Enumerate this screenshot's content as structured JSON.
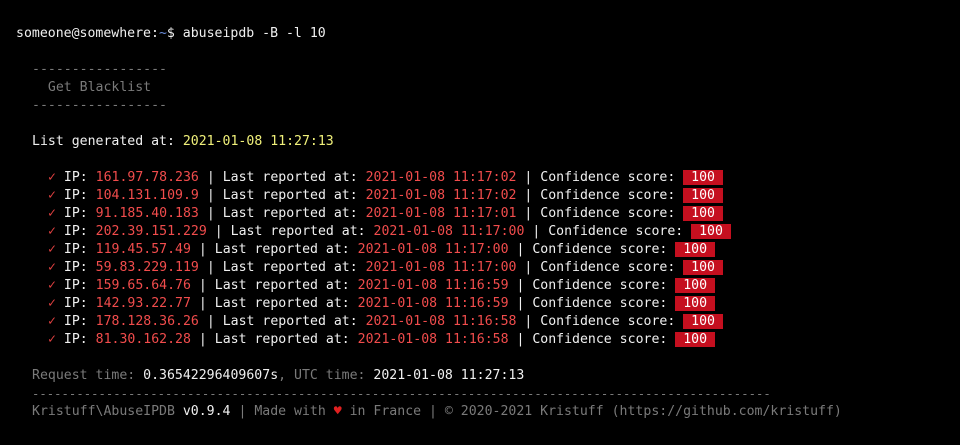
{
  "prompt": {
    "user_host": "someone@somewhere",
    "colon": ":",
    "path": "~",
    "dollar": "$ ",
    "command": "abuseipdb -B -l 10"
  },
  "header": {
    "rule_top": "-----------------",
    "title": "  Get Blacklist",
    "rule_bottom": "-----------------"
  },
  "generated": {
    "label": "List generated at: ",
    "value": "2021-01-08 11:27:13"
  },
  "rows": [
    {
      "check": "✓",
      "ip_label": " IP: ",
      "ip": "161.97.78.236",
      "sep1": " | Last reported at: ",
      "date": "2021-01-08 11:17:02",
      "sep2": " | Confidence score: ",
      "score": " 100 "
    },
    {
      "check": "✓",
      "ip_label": " IP: ",
      "ip": "104.131.109.9",
      "sep1": " | Last reported at: ",
      "date": "2021-01-08 11:17:02",
      "sep2": " | Confidence score: ",
      "score": " 100 "
    },
    {
      "check": "✓",
      "ip_label": " IP: ",
      "ip": "91.185.40.183",
      "sep1": " | Last reported at: ",
      "date": "2021-01-08 11:17:01",
      "sep2": " | Confidence score: ",
      "score": " 100 "
    },
    {
      "check": "✓",
      "ip_label": " IP: ",
      "ip": "202.39.151.229",
      "sep1": " | Last reported at: ",
      "date": "2021-01-08 11:17:00",
      "sep2": " | Confidence score: ",
      "score": " 100 "
    },
    {
      "check": "✓",
      "ip_label": " IP: ",
      "ip": "119.45.57.49",
      "sep1": " | Last reported at: ",
      "date": "2021-01-08 11:17:00",
      "sep2": " | Confidence score: ",
      "score": " 100 "
    },
    {
      "check": "✓",
      "ip_label": " IP: ",
      "ip": "59.83.229.119",
      "sep1": " | Last reported at: ",
      "date": "2021-01-08 11:17:00",
      "sep2": " | Confidence score: ",
      "score": " 100 "
    },
    {
      "check": "✓",
      "ip_label": " IP: ",
      "ip": "159.65.64.76",
      "sep1": " | Last reported at: ",
      "date": "2021-01-08 11:16:59",
      "sep2": " | Confidence score: ",
      "score": " 100 "
    },
    {
      "check": "✓",
      "ip_label": " IP: ",
      "ip": "142.93.22.77",
      "sep1": " | Last reported at: ",
      "date": "2021-01-08 11:16:59",
      "sep2": " | Confidence score: ",
      "score": " 100 "
    },
    {
      "check": "✓",
      "ip_label": " IP: ",
      "ip": "178.128.36.26",
      "sep1": " | Last reported at: ",
      "date": "2021-01-08 11:16:58",
      "sep2": " | Confidence score: ",
      "score": " 100 "
    },
    {
      "check": "✓",
      "ip_label": " IP: ",
      "ip": "81.30.162.28",
      "sep1": " | Last reported at: ",
      "date": "2021-01-08 11:16:58",
      "sep2": " | Confidence score: ",
      "score": " 100 "
    }
  ],
  "request": {
    "label": "Request time: ",
    "value": "0.36542296409607s",
    "utc_label": ", UTC time: ",
    "utc_value": "2021-01-08 11:27:13"
  },
  "footer": {
    "rule": "----------------------------------------------------------------------------------------------------",
    "brand": "Kristuff\\AbuseIPDB ",
    "version": "v0.9.4",
    "made_with": " | Made with ",
    "heart": "♥",
    "in_france": " in France | © 2020-2021 Kristuff (https://github.com/kristuff)"
  }
}
